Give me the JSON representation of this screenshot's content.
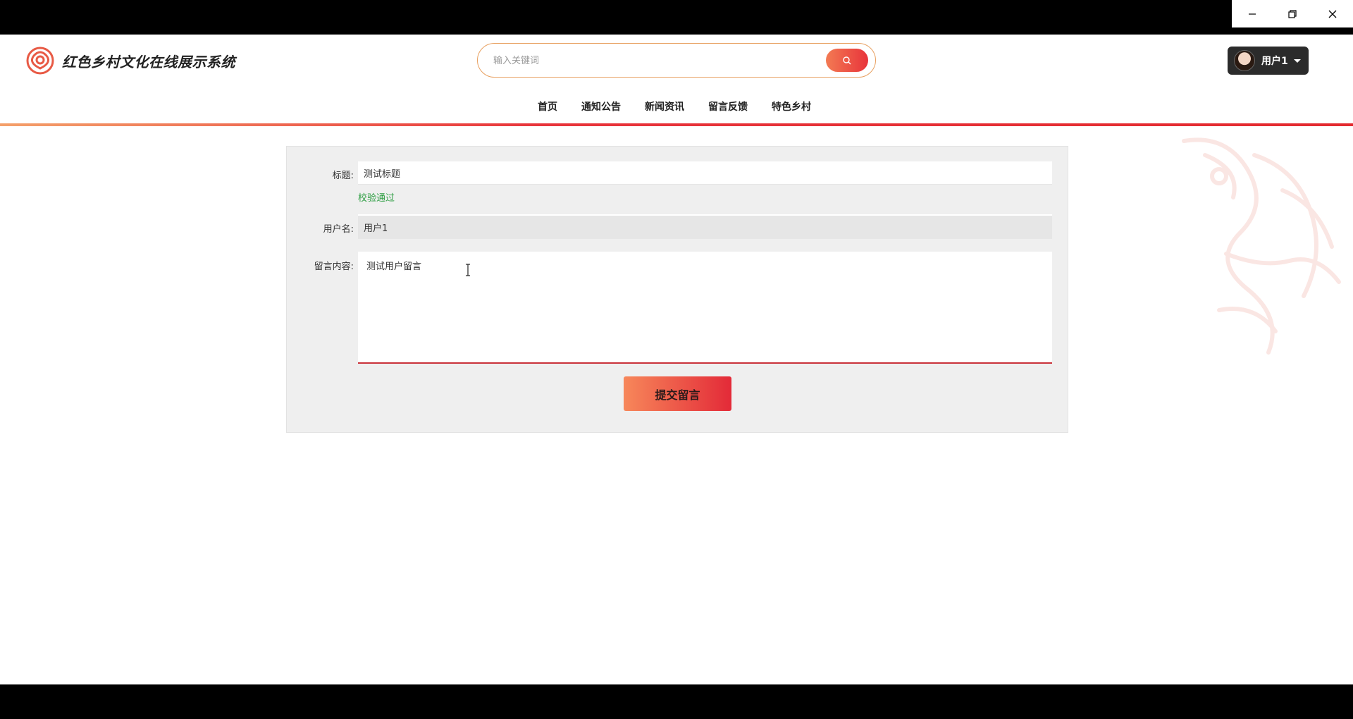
{
  "window": {
    "minimize_icon": "minimize-icon",
    "restore_icon": "restore-icon",
    "close_icon": "close-icon"
  },
  "header": {
    "site_title": "红色乡村文化在线展示系统",
    "search": {
      "placeholder": "输入关键词",
      "button_icon": "search-icon"
    },
    "user": {
      "name": "用户1"
    },
    "nav": [
      "首页",
      "通知公告",
      "新闻资讯",
      "留言反馈",
      "特色乡村"
    ]
  },
  "form": {
    "title_label": "标题:",
    "title_value": "测试标题",
    "title_validation": "校验通过",
    "username_label": "用户名:",
    "username_value": "用户1",
    "content_label": "留言内容:",
    "content_value": "测试用户留言",
    "submit_label": "提交留言"
  },
  "colors": {
    "accent_start": "#f37a53",
    "accent_end": "#e8343b",
    "success": "#2e9e43"
  }
}
